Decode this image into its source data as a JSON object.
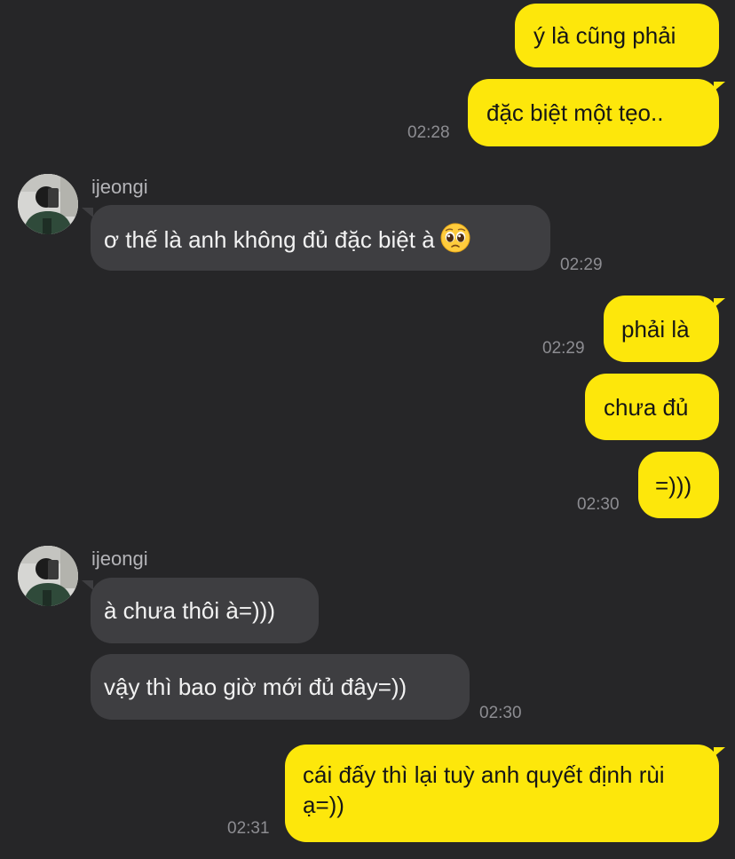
{
  "contact": {
    "name": "ijeongi"
  },
  "messages": {
    "m1": {
      "text": "ý là cũng phải"
    },
    "m2": {
      "text": "đặc biệt một tẹo..",
      "time": "02:28"
    },
    "m3": {
      "text": "ơ thế là anh không đủ đặc biệt à",
      "emoji": "pleading-face-icon",
      "time": "02:29"
    },
    "m4": {
      "text": "phải là",
      "time": "02:29"
    },
    "m5": {
      "text": "chưa đủ"
    },
    "m6": {
      "text": "=)))",
      "time": "02:30"
    },
    "m7": {
      "text": "à chưa thôi à=)))"
    },
    "m8": {
      "text": "vậy thì bao giờ mới đủ đây=))",
      "time": "02:30"
    },
    "m9": {
      "text": "cái đấy thì lại tuỳ anh quyết định rùi ạ=))",
      "time": "02:31"
    }
  },
  "colors": {
    "background": "#262628",
    "outgoing_bubble": "#fde70b",
    "incoming_bubble": "#3e3e41",
    "timestamp": "#8d8d92"
  }
}
